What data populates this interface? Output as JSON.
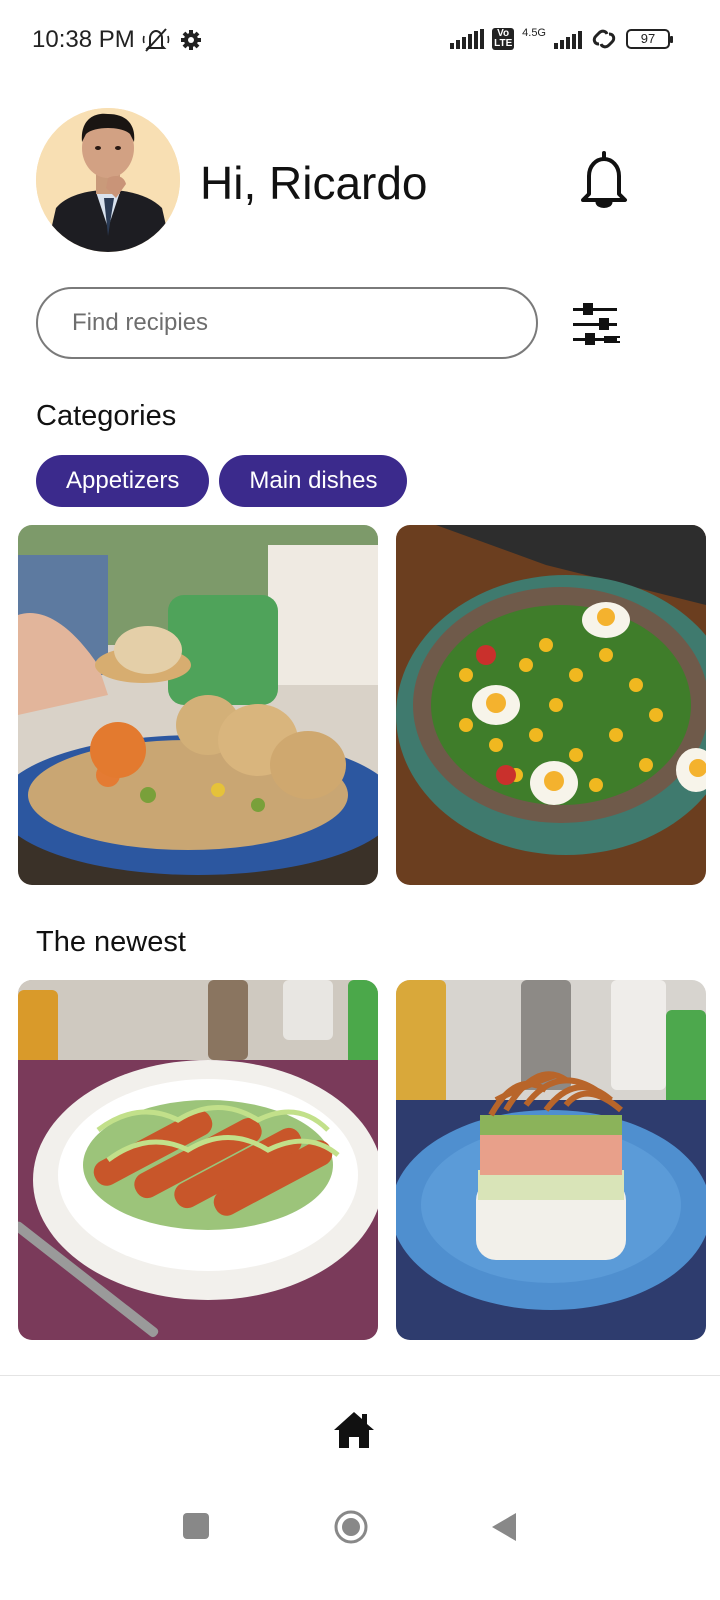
{
  "status_bar": {
    "time": "10:38 PM",
    "network_type": "4.5G",
    "volte": "Vo LTE",
    "battery_level": "97"
  },
  "header": {
    "greeting": "Hi, Ricardo"
  },
  "search": {
    "placeholder": "Find recipies"
  },
  "categories": {
    "title": "Categories",
    "chips": [
      "Appetizers",
      "Main dishes"
    ]
  },
  "newest": {
    "title": "The newest"
  },
  "colors": {
    "chip_background": "#3b2a8c",
    "chip_text": "#ffffff"
  },
  "icons": {
    "notification": "bell-icon",
    "filter": "sliders-icon",
    "home": "home-icon"
  }
}
